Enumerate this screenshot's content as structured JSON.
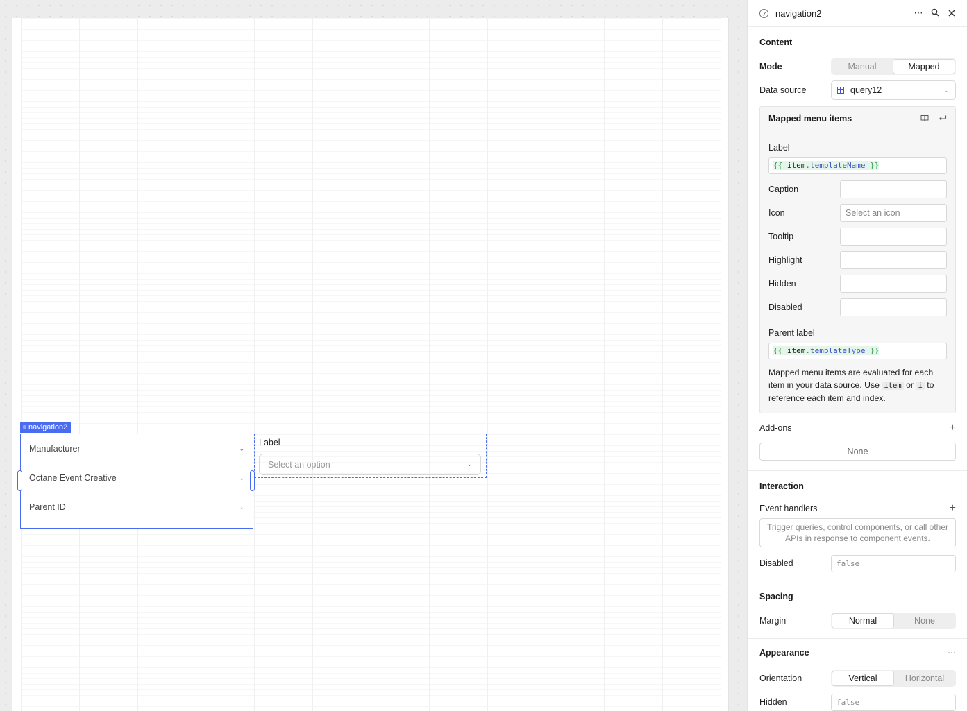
{
  "canvas": {
    "component_tag": "navigation2",
    "nav_items": [
      {
        "label": "Manufacturer"
      },
      {
        "label": "Octane Event Creative"
      },
      {
        "label": "Parent ID"
      }
    ],
    "select_component": {
      "label": "Label",
      "placeholder": "Select an option"
    }
  },
  "inspector": {
    "title": "navigation2",
    "content": {
      "title": "Content",
      "mode_label": "Mode",
      "mode_options": [
        "Manual",
        "Mapped"
      ],
      "mode_selected": "Mapped",
      "data_source_label": "Data source",
      "data_source_value": "query12",
      "mapped": {
        "title": "Mapped menu items",
        "label_field": "Label",
        "label_value": {
          "open": "{{",
          "obj": "item",
          "prop": "templateName",
          "close": "}}"
        },
        "fields": [
          {
            "label": "Caption",
            "value": ""
          },
          {
            "label": "Icon",
            "value": "Select an icon"
          },
          {
            "label": "Tooltip",
            "value": ""
          },
          {
            "label": "Highlight",
            "value": ""
          },
          {
            "label": "Hidden",
            "value": ""
          },
          {
            "label": "Disabled",
            "value": ""
          }
        ],
        "parent_label_field": "Parent label",
        "parent_label_value": {
          "open": "{{",
          "obj": "item",
          "prop": "templateType",
          "close": "}}"
        },
        "help_prefix": "Mapped menu items are evaluated for each item in your data source. Use",
        "help_code1": "item",
        "help_mid": "or",
        "help_code2": "i",
        "help_suffix": "to reference each item and index."
      },
      "addons_label": "Add-ons",
      "addons_value": "None"
    },
    "interaction": {
      "title": "Interaction",
      "event_handlers_label": "Event handlers",
      "event_handlers_hint": "Trigger queries, control components, or call other APIs in response to component events.",
      "disabled_label": "Disabled",
      "disabled_value": "false"
    },
    "spacing": {
      "title": "Spacing",
      "margin_label": "Margin",
      "margin_options": [
        "Normal",
        "None"
      ],
      "margin_selected": "Normal"
    },
    "appearance": {
      "title": "Appearance",
      "orientation_label": "Orientation",
      "orientation_options": [
        "Vertical",
        "Horizontal"
      ],
      "orientation_selected": "Vertical",
      "hidden_label": "Hidden",
      "hidden_value": "false"
    }
  },
  "colors": {
    "accent": "#4a6cf0",
    "code_green": "#2f9b52",
    "code_blue": "#3b51c9"
  }
}
